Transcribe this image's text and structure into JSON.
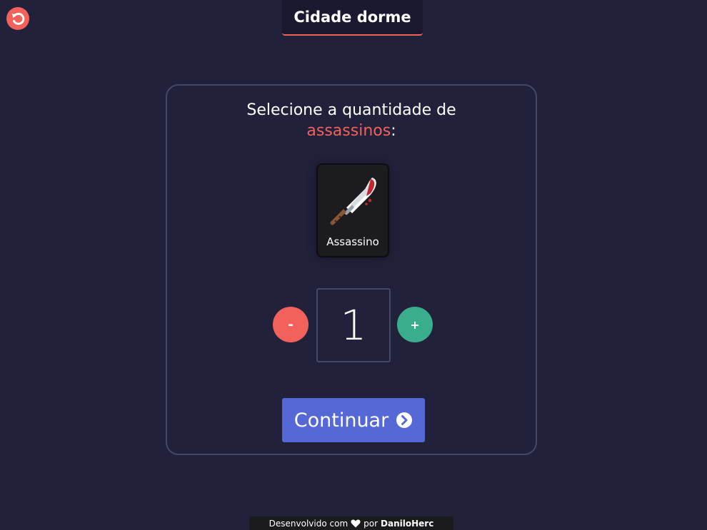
{
  "header": {
    "title": "Cidade dorme",
    "reset_icon": "reset-arrow-icon"
  },
  "prompt": {
    "line1": "Selecione a quantidade de",
    "accent": "assassinos",
    "suffix": ":"
  },
  "role": {
    "label": "Assassino",
    "icon": "bloody-knife-icon"
  },
  "stepper": {
    "minus_label": "-",
    "plus_label": "+",
    "value": "1"
  },
  "continue": {
    "label": "Continuar",
    "icon": "chevron-right-circle-icon"
  },
  "footer": {
    "prefix": "Desenvolvido com",
    "middle": "por",
    "author": "DaniloHerc",
    "icon": "heart-icon"
  },
  "colors": {
    "background": "#22213b",
    "accent_red": "#f2625a",
    "accent_green": "#3aae8c",
    "button_blue": "#5568d6"
  }
}
